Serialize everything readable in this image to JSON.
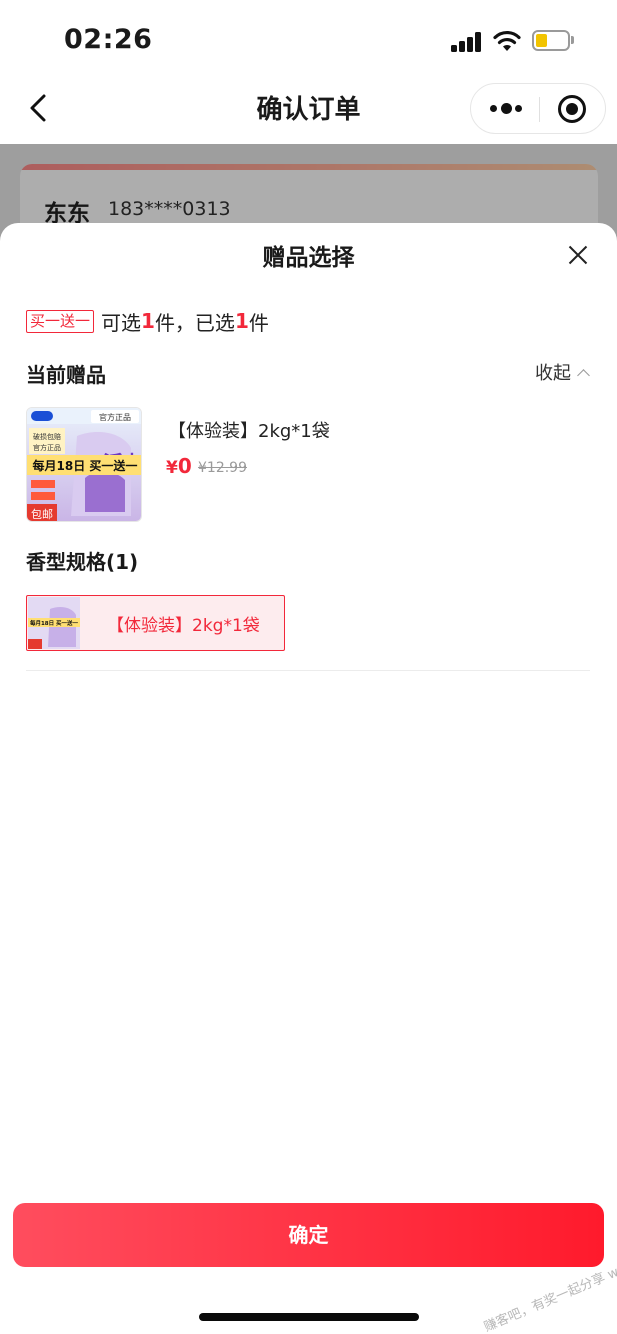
{
  "status_bar": {
    "time": "02:26"
  },
  "nav": {
    "title": "确认订单"
  },
  "address": {
    "name": "东东",
    "phone": "183****0313"
  },
  "sheet": {
    "title": "赠品选择",
    "promo_tag": "买一送一",
    "promo_text_1": "可选",
    "promo_count_selectable": "1",
    "promo_text_2": "件，已选",
    "promo_count_selected": "1",
    "promo_text_3": "件",
    "current_gift_title": "当前赠品",
    "collapse_label": "收起",
    "gift": {
      "name": "【体验装】2kg*1袋",
      "price_symbol": "¥",
      "price": "0",
      "original_price": "¥12.99",
      "image_badge_top": "官方正品",
      "image_banner": "每月18日 买一送一",
      "image_side_1": "破损包赔",
      "image_side_2": "官方正品",
      "image_side_3": "包邮"
    },
    "spec_title": "香型规格(1)",
    "spec_option": {
      "label": "【体验装】2kg*1袋",
      "thumb_banner": "每月18日 买一送一"
    },
    "confirm_label": "确定"
  },
  "watermark": "赚客吧，有奖一起分享 www.zuanke8.com",
  "colors": {
    "accent": "#f2283a",
    "button_start": "#ff4d5e",
    "button_end": "#ff1a2c"
  }
}
